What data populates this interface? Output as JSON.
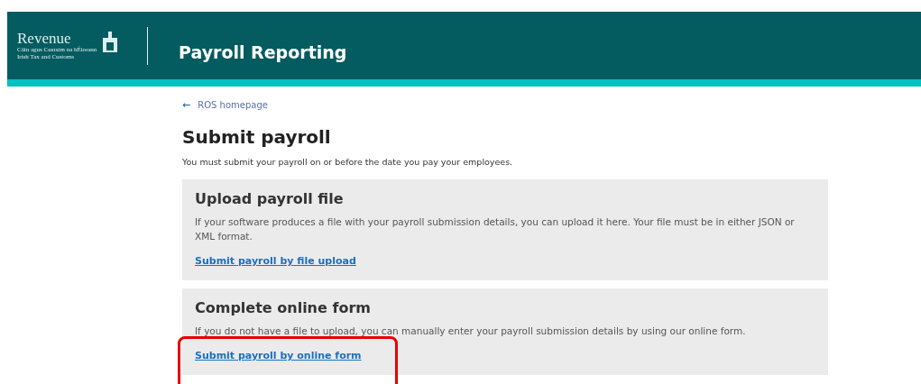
{
  "header": {
    "logo_name": "Revenue",
    "logo_tagline": [
      "Cáin agus Custaim na hÉireann",
      "Irish Tax and Customs"
    ],
    "title": "Payroll Reporting"
  },
  "back_link": {
    "arrow": "←",
    "label": "ROS homepage"
  },
  "page_title": "Submit payroll",
  "intro": "You must submit your payroll on or before the date you pay your employees.",
  "options": [
    {
      "heading": "Upload payroll file",
      "description": "If your software produces a file with your payroll submission details, you can upload it here. Your file must be in either JSON or XML format.",
      "link": "Submit payroll by file upload",
      "highlighted": false
    },
    {
      "heading": "Complete online form",
      "description": "If you do not have a file to upload, you can manually enter your payroll submission details by using our online form.",
      "link": "Submit payroll by online form",
      "highlighted": true
    }
  ]
}
